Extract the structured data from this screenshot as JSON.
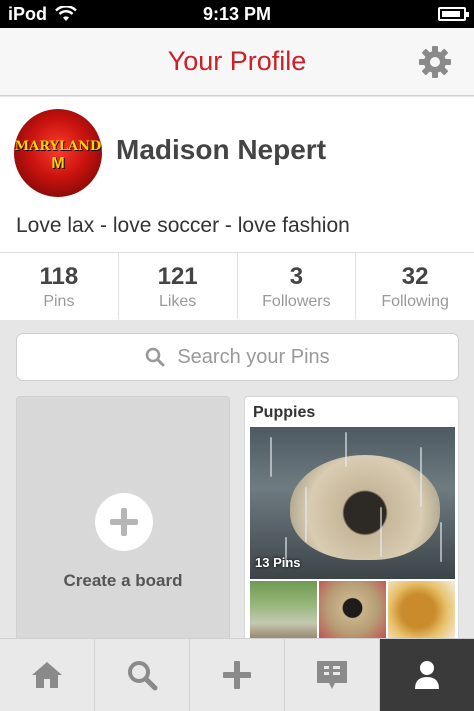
{
  "status_bar": {
    "carrier": "iPod",
    "time": "9:13 PM"
  },
  "header": {
    "title": "Your Profile",
    "settings_icon": "gear-icon"
  },
  "profile": {
    "name": "Madison Nepert",
    "bio": "Love lax - love soccer - love fashion",
    "avatar_text": "MARYLAND",
    "avatar_mark": "M"
  },
  "stats": [
    {
      "value": "118",
      "label": "Pins"
    },
    {
      "value": "121",
      "label": "Likes"
    },
    {
      "value": "3",
      "label": "Followers"
    },
    {
      "value": "32",
      "label": "Following"
    }
  ],
  "search": {
    "placeholder": "Search your Pins",
    "icon": "search-icon"
  },
  "create_board": {
    "label": "Create a board",
    "icon": "plus-icon"
  },
  "board": {
    "title": "Puppies",
    "pin_count": "13 Pins"
  },
  "tabbar": {
    "tabs": [
      {
        "name": "home",
        "icon": "home-icon"
      },
      {
        "name": "search",
        "icon": "search-icon"
      },
      {
        "name": "add",
        "icon": "plus-icon"
      },
      {
        "name": "news",
        "icon": "news-icon"
      },
      {
        "name": "profile",
        "icon": "person-icon",
        "active": true
      }
    ]
  },
  "colors": {
    "accent": "#cb2027",
    "active_tab": "#3a3a3a"
  }
}
